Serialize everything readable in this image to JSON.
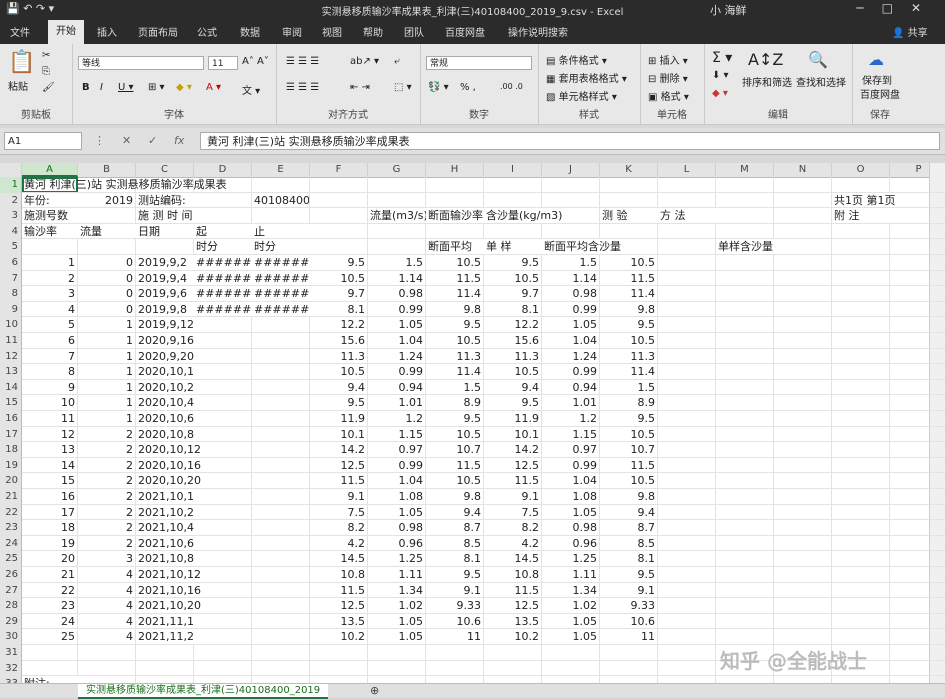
{
  "window": {
    "title": "实测悬移质输沙率成果表_利津(三)40108400_2019_9.csv  -  Excel",
    "user": "小 海鲜",
    "controls": [
      "─",
      "□",
      "✕"
    ]
  },
  "ribbon_tabs": [
    "文件",
    "开始",
    "插入",
    "页面布局",
    "公式",
    "数据",
    "审阅",
    "视图",
    "帮助",
    "团队",
    "百度网盘",
    "操作说明搜索"
  ],
  "share": "共享",
  "ribbon": {
    "clipboard": {
      "label": "剪贴板",
      "paste": "粘贴"
    },
    "font": {
      "label": "字体",
      "name": "等线",
      "size": "11"
    },
    "align": {
      "label": "对齐方式"
    },
    "number": {
      "label": "数字",
      "format": "常规",
      "symbols": "% ,"
    },
    "styles": {
      "label": "样式",
      "cond": "条件格式",
      "table": "套用表格格式",
      "cell": "单元格样式"
    },
    "cells": {
      "label": "单元格",
      "insert": "插入",
      "delete": "删除",
      "format": "格式"
    },
    "edit": {
      "label": "编辑",
      "sort": "排序和筛选",
      "find": "查找和选择"
    },
    "save": {
      "label": "保存",
      "btn1": "保存到",
      "btn2": "百度网盘"
    }
  },
  "formula_bar": {
    "namebox": "A1",
    "content": "黄河 利津(三)站 实测悬移质输沙率成果表"
  },
  "columns": [
    "A",
    "B",
    "C",
    "D",
    "E",
    "F",
    "G",
    "H",
    "I",
    "J",
    "K",
    "L",
    "M",
    "N",
    "O",
    "P"
  ],
  "rows": [
    [
      "黄河 利津(三)站 实测悬移质输沙率成果表",
      "",
      "",
      "",
      "",
      "",
      "",
      "",
      "",
      "",
      "",
      "",
      "",
      "",
      "",
      ""
    ],
    [
      "年份:",
      "2019",
      "测站编码:",
      "",
      "40108400",
      "",
      "",
      "",
      "",
      "",
      "",
      "",
      "",
      "",
      "共1页 第1页",
      ""
    ],
    [
      "施测号数",
      "",
      "施 测 时 间",
      "",
      "",
      "",
      "流量(m3/s)",
      "断面输沙率(",
      "含沙量(kg/m3)",
      "",
      "测    验",
      "方    法",
      "",
      "",
      "附    注",
      ""
    ],
    [
      "输沙率",
      "流量",
      "日期",
      "起",
      "止",
      "",
      "",
      "",
      "",
      "",
      "",
      "",
      "",
      "",
      "",
      ""
    ],
    [
      "",
      "",
      "",
      "时分",
      "时分",
      "",
      "",
      "断面平均",
      "单 样",
      "断面平均含沙量",
      "",
      "",
      "单样含沙量",
      "",
      "",
      ""
    ],
    [
      "1",
      "0",
      "2019,9,2",
      "########",
      "########",
      "9.5",
      "1.5",
      "10.5",
      "9.5",
      "1.5",
      "10.5",
      "",
      "",
      "",
      "",
      ""
    ],
    [
      "2",
      "0",
      "2019,9,4",
      "########",
      "########",
      "10.5",
      "1.14",
      "11.5",
      "10.5",
      "1.14",
      "11.5",
      "",
      "",
      "",
      "",
      ""
    ],
    [
      "3",
      "0",
      "2019,9,6",
      "########",
      "########",
      "9.7",
      "0.98",
      "11.4",
      "9.7",
      "0.98",
      "11.4",
      "",
      "",
      "",
      "",
      ""
    ],
    [
      "4",
      "0",
      "2019,9,8",
      "########",
      "########",
      "8.1",
      "0.99",
      "9.8",
      "8.1",
      "0.99",
      "9.8",
      "",
      "",
      "",
      "",
      ""
    ],
    [
      "5",
      "1",
      "2019,9,12",
      "",
      "",
      "12.2",
      "1.05",
      "9.5",
      "12.2",
      "1.05",
      "9.5",
      "",
      "",
      "",
      "",
      ""
    ],
    [
      "6",
      "1",
      "2020,9,16",
      "",
      "",
      "15.6",
      "1.04",
      "10.5",
      "15.6",
      "1.04",
      "10.5",
      "",
      "",
      "",
      "",
      ""
    ],
    [
      "7",
      "1",
      "2020,9,20",
      "",
      "",
      "11.3",
      "1.24",
      "11.3",
      "11.3",
      "1.24",
      "11.3",
      "",
      "",
      "",
      "",
      ""
    ],
    [
      "8",
      "1",
      "2020,10,1",
      "",
      "",
      "10.5",
      "0.99",
      "11.4",
      "10.5",
      "0.99",
      "11.4",
      "",
      "",
      "",
      "",
      ""
    ],
    [
      "9",
      "1",
      "2020,10,2",
      "",
      "",
      "9.4",
      "0.94",
      "1.5",
      "9.4",
      "0.94",
      "1.5",
      "",
      "",
      "",
      "",
      ""
    ],
    [
      "10",
      "1",
      "2020,10,4",
      "",
      "",
      "9.5",
      "1.01",
      "8.9",
      "9.5",
      "1.01",
      "8.9",
      "",
      "",
      "",
      "",
      ""
    ],
    [
      "11",
      "1",
      "2020,10,6",
      "",
      "",
      "11.9",
      "1.2",
      "9.5",
      "11.9",
      "1.2",
      "9.5",
      "",
      "",
      "",
      "",
      ""
    ],
    [
      "12",
      "2",
      "2020,10,8",
      "",
      "",
      "10.1",
      "1.15",
      "10.5",
      "10.1",
      "1.15",
      "10.5",
      "",
      "",
      "",
      "",
      ""
    ],
    [
      "13",
      "2",
      "2020,10,12",
      "",
      "",
      "14.2",
      "0.97",
      "10.7",
      "14.2",
      "0.97",
      "10.7",
      "",
      "",
      "",
      "",
      ""
    ],
    [
      "14",
      "2",
      "2020,10,16",
      "",
      "",
      "12.5",
      "0.99",
      "11.5",
      "12.5",
      "0.99",
      "11.5",
      "",
      "",
      "",
      "",
      ""
    ],
    [
      "15",
      "2",
      "2020,10,20",
      "",
      "",
      "11.5",
      "1.04",
      "10.5",
      "11.5",
      "1.04",
      "10.5",
      "",
      "",
      "",
      "",
      ""
    ],
    [
      "16",
      "2",
      "2021,10,1",
      "",
      "",
      "9.1",
      "1.08",
      "9.8",
      "9.1",
      "1.08",
      "9.8",
      "",
      "",
      "",
      "",
      ""
    ],
    [
      "17",
      "2",
      "2021,10,2",
      "",
      "",
      "7.5",
      "1.05",
      "9.4",
      "7.5",
      "1.05",
      "9.4",
      "",
      "",
      "",
      "",
      ""
    ],
    [
      "18",
      "2",
      "2021,10,4",
      "",
      "",
      "8.2",
      "0.98",
      "8.7",
      "8.2",
      "0.98",
      "8.7",
      "",
      "",
      "",
      "",
      ""
    ],
    [
      "19",
      "2",
      "2021,10,6",
      "",
      "",
      "4.2",
      "0.96",
      "8.5",
      "4.2",
      "0.96",
      "8.5",
      "",
      "",
      "",
      "",
      ""
    ],
    [
      "20",
      "3",
      "2021,10,8",
      "",
      "",
      "14.5",
      "1.25",
      "8.1",
      "14.5",
      "1.25",
      "8.1",
      "",
      "",
      "",
      "",
      ""
    ],
    [
      "21",
      "4",
      "2021,10,12",
      "",
      "",
      "10.8",
      "1.11",
      "9.5",
      "10.8",
      "1.11",
      "9.5",
      "",
      "",
      "",
      "",
      ""
    ],
    [
      "22",
      "4",
      "2021,10,16",
      "",
      "",
      "11.5",
      "1.34",
      "9.1",
      "11.5",
      "1.34",
      "9.1",
      "",
      "",
      "",
      "",
      ""
    ],
    [
      "23",
      "4",
      "2021,10,20",
      "",
      "",
      "12.5",
      "1.02",
      "9.33",
      "12.5",
      "1.02",
      "9.33",
      "",
      "",
      "",
      "",
      ""
    ],
    [
      "24",
      "4",
      "2021,11,1",
      "",
      "",
      "13.5",
      "1.05",
      "10.6",
      "13.5",
      "1.05",
      "10.6",
      "",
      "",
      "",
      "",
      ""
    ],
    [
      "25",
      "4",
      "2021,11,2",
      "",
      "",
      "10.2",
      "1.05",
      "11",
      "10.2",
      "1.05",
      "11",
      "",
      "",
      "",
      "",
      ""
    ],
    [
      "",
      "",
      "",
      "",
      "",
      "",
      "",
      "",
      "",
      "",
      "",
      "",
      "",
      "",
      "",
      ""
    ],
    [
      "",
      "",
      "",
      "",
      "",
      "",
      "",
      "",
      "",
      "",
      "",
      "",
      "",
      "",
      "",
      ""
    ],
    [
      "附注:",
      "",
      "",
      "",
      "",
      "",
      "",
      "",
      "",
      "",
      "",
      "",
      "",
      "",
      "",
      ""
    ]
  ],
  "sheet_tab": "实测悬移质输沙率成果表_利津(三)40108400_2019",
  "add_sheet": "⊕",
  "watermark": "知乎 @全能战士"
}
